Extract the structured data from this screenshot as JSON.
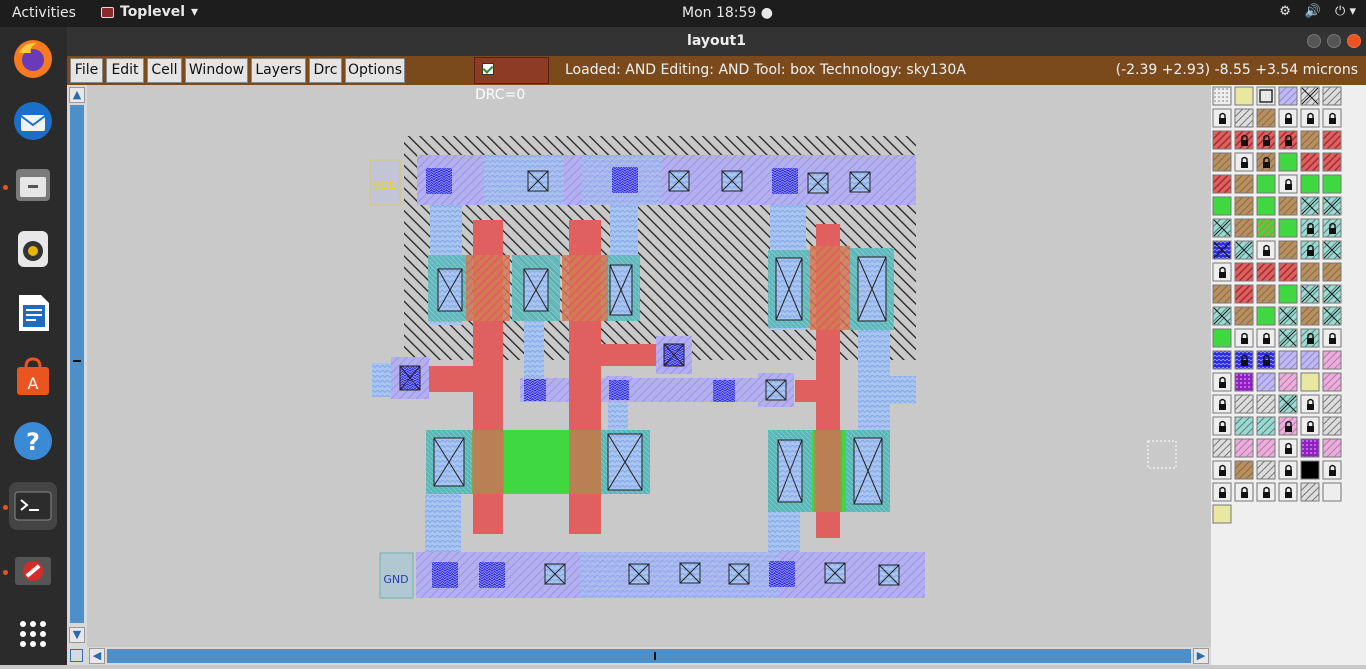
{
  "topbar": {
    "activities": "Activities",
    "app_name": "Toplevel",
    "clock": "Mon 18:59"
  },
  "window": {
    "title": "layout1"
  },
  "menu": {
    "items": [
      "File",
      "Edit",
      "Cell",
      "Window",
      "Layers",
      "Drc",
      "Options"
    ],
    "drc_label": "DRC=0",
    "status": "Loaded: AND Editing: AND Tool: box  Technology: sky130A",
    "coords": "(-2.39 +2.93) -8.55 +3.54 microns"
  },
  "dock": {
    "icons": [
      "firefox-icon",
      "thunderbird-icon",
      "files-icon",
      "rhythmbox-icon",
      "writer-icon",
      "software-icon",
      "help-icon",
      "terminal-icon",
      "blocked-app-icon",
      "app-grid-icon"
    ]
  },
  "layout": {
    "labels": {
      "vdd": "VDD",
      "gnd": "GND"
    }
  },
  "colors": {
    "poly": "#e06060",
    "diff": "#40e040",
    "metal1": "#a8a8f0",
    "local": "#9ec0f0",
    "menubar": "#7a4a1c"
  }
}
